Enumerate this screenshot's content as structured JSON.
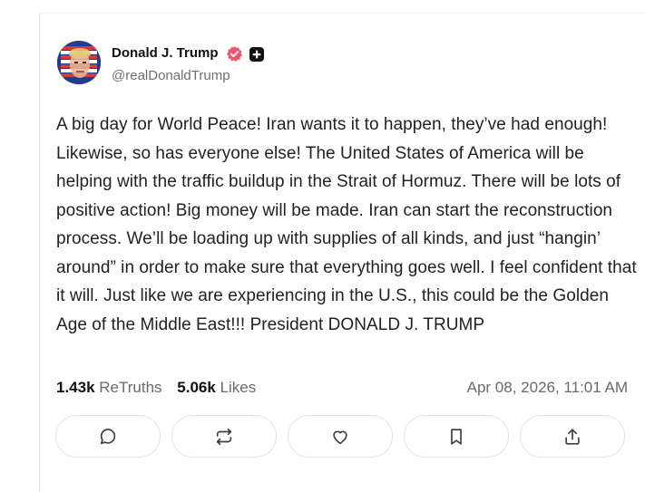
{
  "post": {
    "display_name": "Donald J. Trump",
    "handle": "@realDonaldTrump",
    "verified_icon": "verified-badge-icon",
    "plus_icon": "plus-badge-icon",
    "text": "A big day for World Peace! Iran wants it to happen, they’ve had enough! Likewise, so has everyone else! The United States of America will be helping with the traffic buildup in the Strait of Hormuz. There will be lots of positive action! Big money will be made. Iran can start the reconstruction process. We’ll be loading up with supplies of all kinds, and just “hangin’ around” in order to make sure that everything goes well. I feel confident that it will. Just like we are experiencing in the U.S., this could be the Golden Age of the Middle East!!! President DONALD J. TRUMP"
  },
  "stats": {
    "retruths_count": "1.43k",
    "retruths_label": "ReTruths",
    "likes_count": "5.06k",
    "likes_label": "Likes",
    "timestamp": "Apr 08, 2026, 11:01 AM"
  },
  "actions": [
    {
      "name": "reply",
      "icon": "comment-icon"
    },
    {
      "name": "retruth",
      "icon": "retruth-icon"
    },
    {
      "name": "like",
      "icon": "heart-icon"
    },
    {
      "name": "bookmark",
      "icon": "bookmark-icon"
    },
    {
      "name": "share",
      "icon": "share-icon"
    }
  ],
  "colors": {
    "verified": "#f0546a",
    "text": "#222222",
    "muted": "#6a6a6a",
    "border": "#e2e2e2"
  }
}
